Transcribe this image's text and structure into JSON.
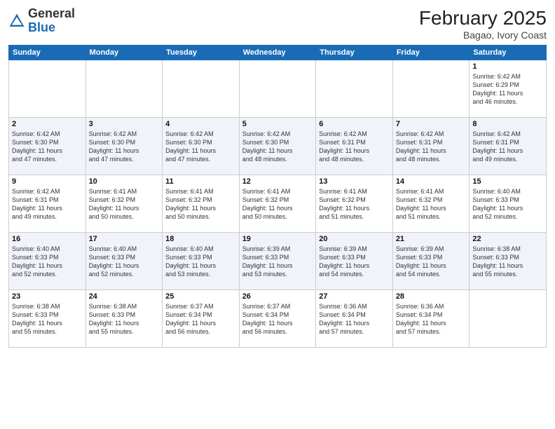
{
  "header": {
    "logo_general": "General",
    "logo_blue": "Blue",
    "month_title": "February 2025",
    "subtitle": "Bagao, Ivory Coast"
  },
  "days_of_week": [
    "Sunday",
    "Monday",
    "Tuesday",
    "Wednesday",
    "Thursday",
    "Friday",
    "Saturday"
  ],
  "weeks": [
    [
      {
        "day": "",
        "info": ""
      },
      {
        "day": "",
        "info": ""
      },
      {
        "day": "",
        "info": ""
      },
      {
        "day": "",
        "info": ""
      },
      {
        "day": "",
        "info": ""
      },
      {
        "day": "",
        "info": ""
      },
      {
        "day": "1",
        "info": "Sunrise: 6:42 AM\nSunset: 6:29 PM\nDaylight: 11 hours\nand 46 minutes."
      }
    ],
    [
      {
        "day": "2",
        "info": "Sunrise: 6:42 AM\nSunset: 6:30 PM\nDaylight: 11 hours\nand 47 minutes."
      },
      {
        "day": "3",
        "info": "Sunrise: 6:42 AM\nSunset: 6:30 PM\nDaylight: 11 hours\nand 47 minutes."
      },
      {
        "day": "4",
        "info": "Sunrise: 6:42 AM\nSunset: 6:30 PM\nDaylight: 11 hours\nand 47 minutes."
      },
      {
        "day": "5",
        "info": "Sunrise: 6:42 AM\nSunset: 6:30 PM\nDaylight: 11 hours\nand 48 minutes."
      },
      {
        "day": "6",
        "info": "Sunrise: 6:42 AM\nSunset: 6:31 PM\nDaylight: 11 hours\nand 48 minutes."
      },
      {
        "day": "7",
        "info": "Sunrise: 6:42 AM\nSunset: 6:31 PM\nDaylight: 11 hours\nand 48 minutes."
      },
      {
        "day": "8",
        "info": "Sunrise: 6:42 AM\nSunset: 6:31 PM\nDaylight: 11 hours\nand 49 minutes."
      }
    ],
    [
      {
        "day": "9",
        "info": "Sunrise: 6:42 AM\nSunset: 6:31 PM\nDaylight: 11 hours\nand 49 minutes."
      },
      {
        "day": "10",
        "info": "Sunrise: 6:41 AM\nSunset: 6:32 PM\nDaylight: 11 hours\nand 50 minutes."
      },
      {
        "day": "11",
        "info": "Sunrise: 6:41 AM\nSunset: 6:32 PM\nDaylight: 11 hours\nand 50 minutes."
      },
      {
        "day": "12",
        "info": "Sunrise: 6:41 AM\nSunset: 6:32 PM\nDaylight: 11 hours\nand 50 minutes."
      },
      {
        "day": "13",
        "info": "Sunrise: 6:41 AM\nSunset: 6:32 PM\nDaylight: 11 hours\nand 51 minutes."
      },
      {
        "day": "14",
        "info": "Sunrise: 6:41 AM\nSunset: 6:32 PM\nDaylight: 11 hours\nand 51 minutes."
      },
      {
        "day": "15",
        "info": "Sunrise: 6:40 AM\nSunset: 6:33 PM\nDaylight: 11 hours\nand 52 minutes."
      }
    ],
    [
      {
        "day": "16",
        "info": "Sunrise: 6:40 AM\nSunset: 6:33 PM\nDaylight: 11 hours\nand 52 minutes."
      },
      {
        "day": "17",
        "info": "Sunrise: 6:40 AM\nSunset: 6:33 PM\nDaylight: 11 hours\nand 52 minutes."
      },
      {
        "day": "18",
        "info": "Sunrise: 6:40 AM\nSunset: 6:33 PM\nDaylight: 11 hours\nand 53 minutes."
      },
      {
        "day": "19",
        "info": "Sunrise: 6:39 AM\nSunset: 6:33 PM\nDaylight: 11 hours\nand 53 minutes."
      },
      {
        "day": "20",
        "info": "Sunrise: 6:39 AM\nSunset: 6:33 PM\nDaylight: 11 hours\nand 54 minutes."
      },
      {
        "day": "21",
        "info": "Sunrise: 6:39 AM\nSunset: 6:33 PM\nDaylight: 11 hours\nand 54 minutes."
      },
      {
        "day": "22",
        "info": "Sunrise: 6:38 AM\nSunset: 6:33 PM\nDaylight: 11 hours\nand 55 minutes."
      }
    ],
    [
      {
        "day": "23",
        "info": "Sunrise: 6:38 AM\nSunset: 6:33 PM\nDaylight: 11 hours\nand 55 minutes."
      },
      {
        "day": "24",
        "info": "Sunrise: 6:38 AM\nSunset: 6:33 PM\nDaylight: 11 hours\nand 55 minutes."
      },
      {
        "day": "25",
        "info": "Sunrise: 6:37 AM\nSunset: 6:34 PM\nDaylight: 11 hours\nand 56 minutes."
      },
      {
        "day": "26",
        "info": "Sunrise: 6:37 AM\nSunset: 6:34 PM\nDaylight: 11 hours\nand 56 minutes."
      },
      {
        "day": "27",
        "info": "Sunrise: 6:36 AM\nSunset: 6:34 PM\nDaylight: 11 hours\nand 57 minutes."
      },
      {
        "day": "28",
        "info": "Sunrise: 6:36 AM\nSunset: 6:34 PM\nDaylight: 11 hours\nand 57 minutes."
      },
      {
        "day": "",
        "info": ""
      }
    ]
  ]
}
